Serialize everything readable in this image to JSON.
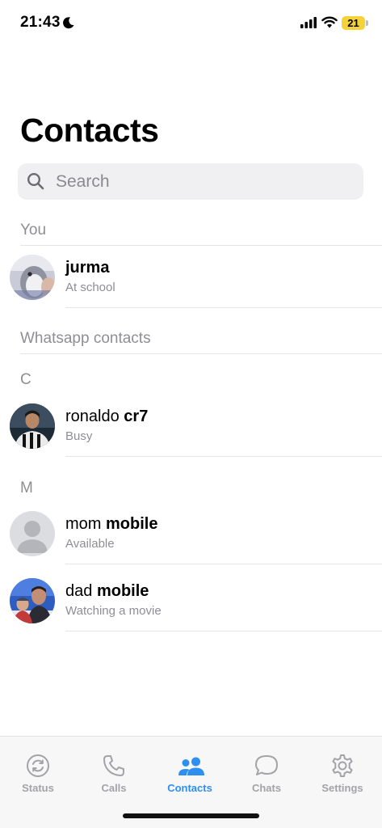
{
  "status_bar": {
    "time": "21:43",
    "battery": "21"
  },
  "title": "Contacts",
  "search": {
    "placeholder": "Search"
  },
  "sections": {
    "you": "You",
    "whatsapp": "Whatsapp contacts",
    "letter_c": "C",
    "letter_m": "M"
  },
  "me": {
    "name": "jurma",
    "status": "At school"
  },
  "contacts": [
    {
      "first": "ronaldo",
      "last": "cr7",
      "status": "Busy"
    },
    {
      "first": "mom",
      "last": "mobile",
      "status": "Available"
    },
    {
      "first": "dad",
      "last": "mobile",
      "status": "Watching a movie"
    }
  ],
  "tabs": [
    {
      "label": "Status",
      "icon": "status-icon",
      "active": false
    },
    {
      "label": "Calls",
      "icon": "phone-icon",
      "active": false
    },
    {
      "label": "Contacts",
      "icon": "contacts-icon",
      "active": true
    },
    {
      "label": "Chats",
      "icon": "chat-bubble-icon",
      "active": false
    },
    {
      "label": "Settings",
      "icon": "gear-icon",
      "active": false
    }
  ],
  "colors": {
    "accent": "#2d8ff0",
    "inactive": "#a3a3a8",
    "secondary_text": "#8e8e93"
  }
}
